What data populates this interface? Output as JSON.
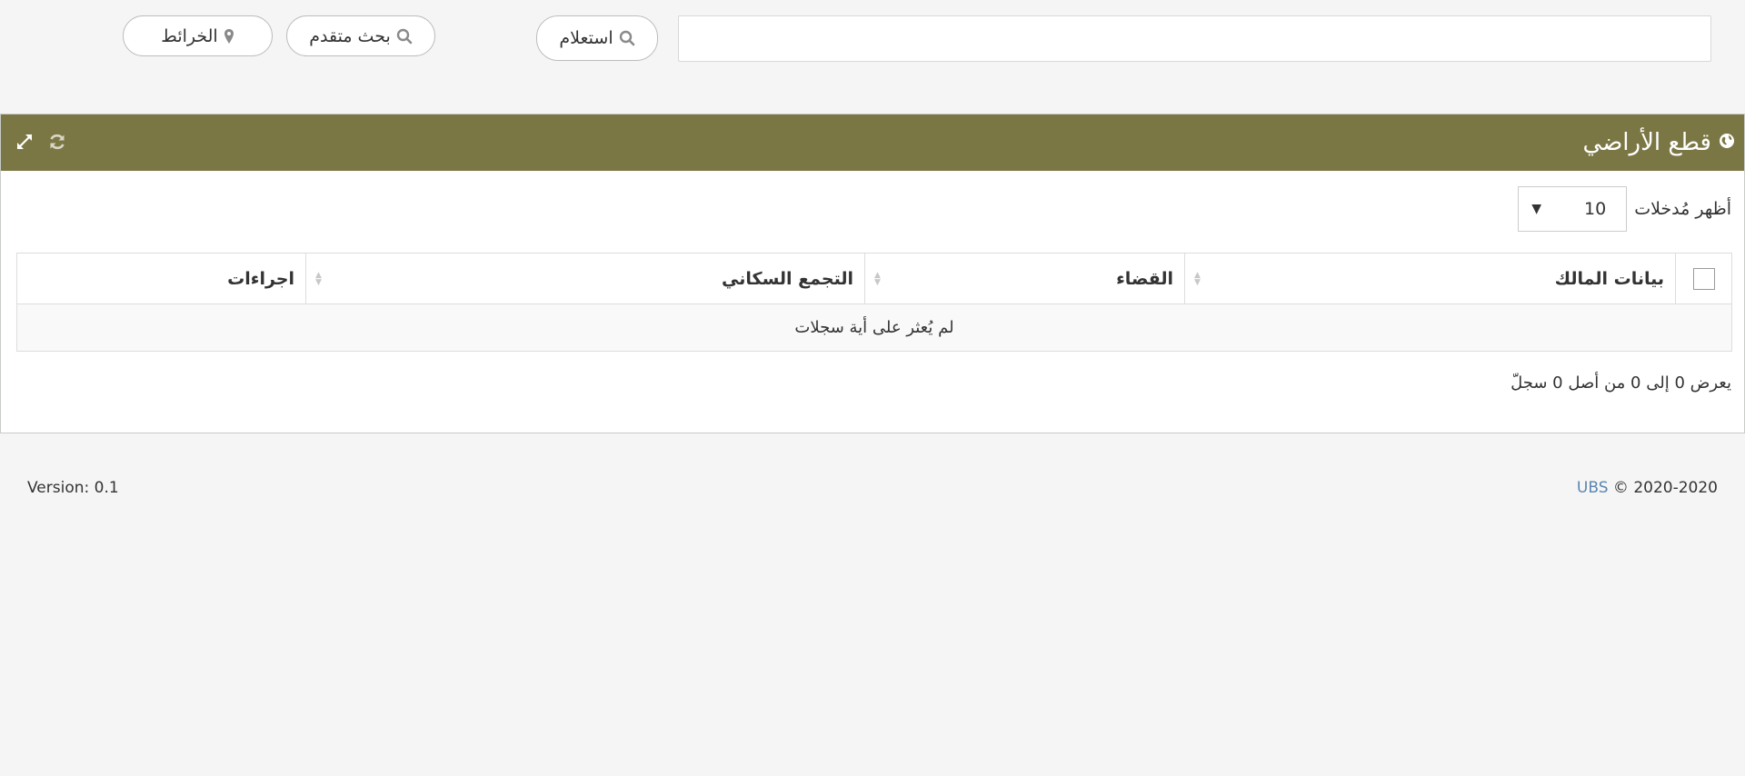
{
  "topbar": {
    "search": {
      "value": "",
      "placeholder": ""
    },
    "query_button": {
      "label": "استعلام",
      "icon": "search-icon"
    },
    "advanced_button": {
      "label": "بحث متقدم",
      "icon": "search-icon"
    },
    "maps_button": {
      "label": "الخرائط",
      "icon": "map-marker-icon"
    }
  },
  "panel": {
    "title": "قطع الأراضي",
    "title_icon": "globe-icon",
    "tools": [
      "refresh-icon",
      "expand-icon"
    ],
    "header_color": "#7b7745"
  },
  "table_controls": {
    "length_label": "أظهر مُدخلات",
    "length_value": "10",
    "length_caret": "▼"
  },
  "table": {
    "columns": [
      "بيانات المالك",
      "القضاء",
      "التجمع السكاني",
      "اجراءات"
    ],
    "empty_message": "لم يُعثر على أية سجلات",
    "sort_up": "▲",
    "sort_down": "▼"
  },
  "info": "يعرض 0 إلى 0 من أصل 0 سجلّ",
  "footer": {
    "version": "Version: 0.1",
    "brand": "UBS",
    "copyright": " © 2020-2020",
    "brand_color": "#5b86b0"
  }
}
